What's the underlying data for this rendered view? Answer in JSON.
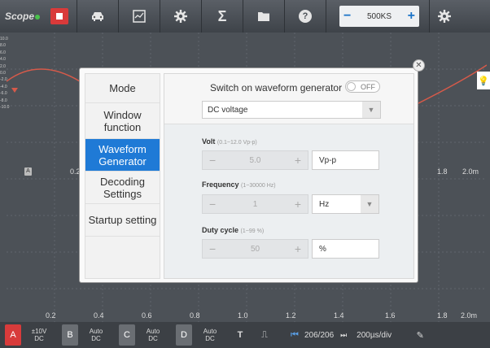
{
  "app": {
    "logo": "Scope"
  },
  "toolbar": {
    "sample_rate": "500KS",
    "minus": "−",
    "plus": "+"
  },
  "scope": {
    "y_ticks": [
      "10.0",
      "8.0",
      "6.0",
      "4.0",
      "2.0",
      "0.0",
      "-2.0",
      "-4.0",
      "-6.0",
      "-8.0",
      "-10.0"
    ],
    "x_ticks_top": [
      "0.2",
      "1.8",
      "2.0m"
    ],
    "x_ticks_bottom": [
      "0.2",
      "0.4",
      "0.6",
      "0.8",
      "1.0",
      "1.2",
      "1.4",
      "1.6",
      "1.8",
      "2.0m"
    ]
  },
  "bottom": {
    "channels": [
      {
        "id": "A",
        "value": "±10V",
        "coupling": "DC",
        "color": "#d83b3b"
      },
      {
        "id": "B",
        "value": "Auto",
        "coupling": "DC",
        "color": "#6a6e73"
      },
      {
        "id": "C",
        "value": "Auto",
        "coupling": "DC",
        "color": "#6a6e73"
      },
      {
        "id": "D",
        "value": "Auto",
        "coupling": "DC",
        "color": "#6a6e73"
      }
    ],
    "pages": "206/206",
    "timebase": "200µs/div"
  },
  "modal": {
    "menu": [
      {
        "label": "Mode",
        "active": false
      },
      {
        "label": "Window function",
        "active": false
      },
      {
        "label": "Waveform Generator",
        "active": true
      },
      {
        "label": "Decoding Settings",
        "active": false
      },
      {
        "label": "Startup setting",
        "active": false
      }
    ],
    "switch_label": "Switch on waveform generator",
    "toggle_state": "OFF",
    "waveform_type": "DC voltage",
    "volt": {
      "label": "Volt",
      "range": "(0.1~12.0 Vp-p)",
      "value": "5.0",
      "unit": "Vp-p"
    },
    "frequency": {
      "label": "Frequency",
      "range": "(1~30000 Hz)",
      "value": "1",
      "unit": "Hz"
    },
    "duty": {
      "label": "Duty cycle",
      "range": "(1~99 %)",
      "value": "50",
      "unit": "%"
    }
  },
  "colors": {
    "accent": "#1f7ad6",
    "stop": "#d93a3a",
    "waveform": "#d65a4a"
  }
}
